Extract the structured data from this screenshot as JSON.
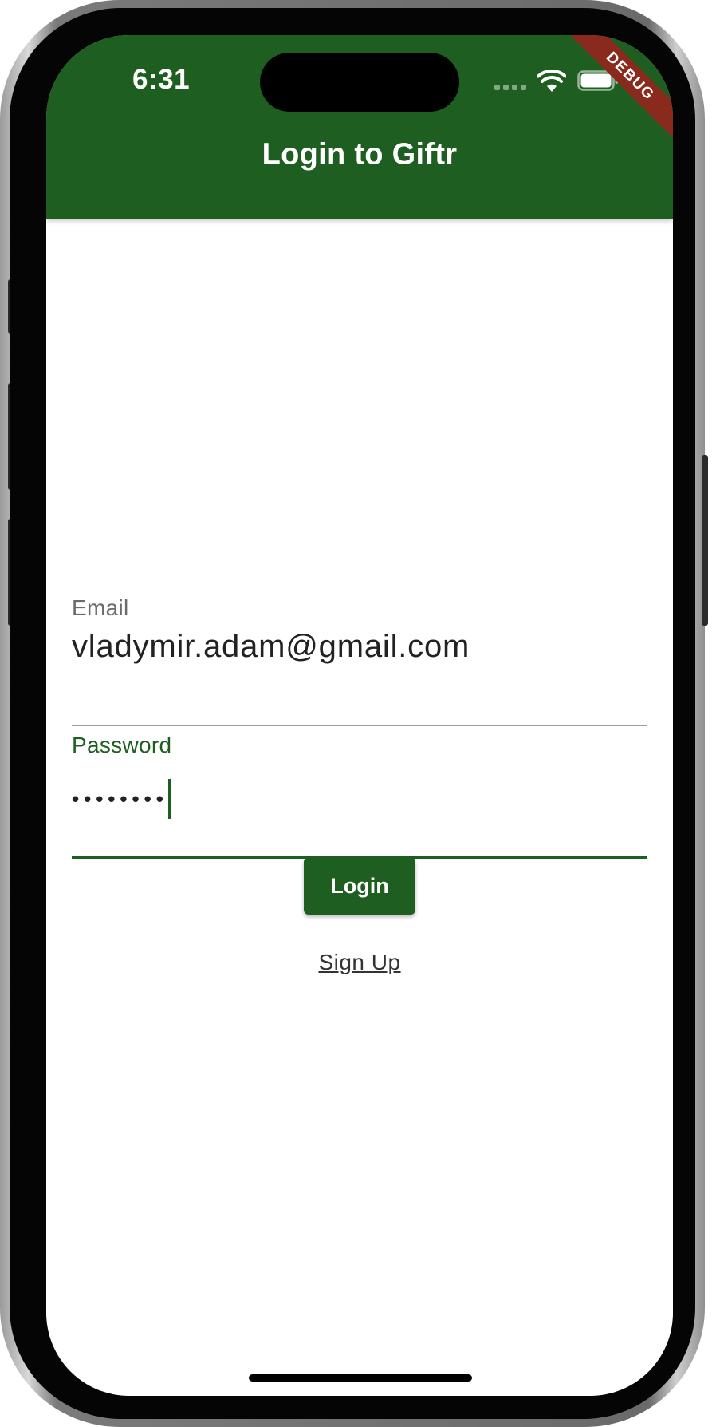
{
  "status_bar": {
    "time": "6:31"
  },
  "app_bar": {
    "title": "Login to Giftr",
    "background_color": "#1e5e20"
  },
  "debug_banner": {
    "label": "DEBUG",
    "color": "#8a2a1d"
  },
  "form": {
    "email": {
      "label": "Email",
      "value": "vladymir.adam@gmail.com"
    },
    "password": {
      "label": "Password",
      "masked_value": "••••••••",
      "focused": true
    }
  },
  "buttons": {
    "login_label": "Login",
    "signup_label": "Sign Up"
  },
  "icons": [
    "cellular-signal-icon",
    "wifi-icon",
    "battery-icon"
  ]
}
